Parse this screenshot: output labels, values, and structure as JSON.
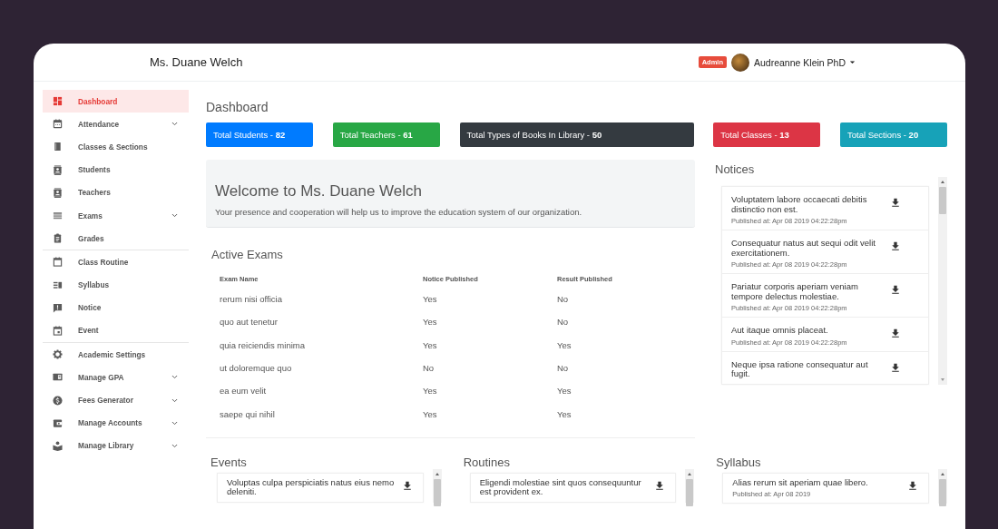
{
  "header": {
    "brand": "Ms. Duane Welch",
    "role_badge": "Admin",
    "user_name": "Audreanne Klein PhD"
  },
  "sidebar": {
    "groups": [
      [
        {
          "label": "Dashboard",
          "selected": true,
          "has_submenu": false
        },
        {
          "label": "Attendance",
          "selected": false,
          "has_submenu": true
        },
        {
          "label": "Classes & Sections",
          "selected": false,
          "has_submenu": false
        },
        {
          "label": "Students",
          "selected": false,
          "has_submenu": false
        },
        {
          "label": "Teachers",
          "selected": false,
          "has_submenu": false
        },
        {
          "label": "Exams",
          "selected": false,
          "has_submenu": true
        },
        {
          "label": "Grades",
          "selected": false,
          "has_submenu": false
        }
      ],
      [
        {
          "label": "Class Routine",
          "selected": false,
          "has_submenu": false
        },
        {
          "label": "Syllabus",
          "selected": false,
          "has_submenu": false
        },
        {
          "label": "Notice",
          "selected": false,
          "has_submenu": false
        },
        {
          "label": "Event",
          "selected": false,
          "has_submenu": false
        }
      ],
      [
        {
          "label": "Academic Settings",
          "selected": false,
          "has_submenu": false
        },
        {
          "label": "Manage GPA",
          "selected": false,
          "has_submenu": true
        },
        {
          "label": "Fees Generator",
          "selected": false,
          "has_submenu": true
        },
        {
          "label": "Manage Accounts",
          "selected": false,
          "has_submenu": true
        },
        {
          "label": "Manage Library",
          "selected": false,
          "has_submenu": true
        }
      ]
    ]
  },
  "page_title": "Dashboard",
  "stats": [
    {
      "label": "Total Students -",
      "value": "82",
      "color": "#007bff"
    },
    {
      "label": "Total Teachers -",
      "value": "61",
      "color": "#28a745"
    },
    {
      "label": "Total Types of Books In Library -",
      "value": "50",
      "color": "#343a40"
    },
    {
      "label": "Total Classes -",
      "value": "13",
      "color": "#dc3545"
    },
    {
      "label": "Total Sections -",
      "value": "20",
      "color": "#17a2b8"
    }
  ],
  "welcome": {
    "title": "Welcome to Ms. Duane Welch",
    "message": "Your presence and cooperation will help us to improve the education system of our organization."
  },
  "active_exams": {
    "title": "Active Exams",
    "columns": [
      "Exam Name",
      "Notice Published",
      "Result Published"
    ],
    "rows": [
      [
        "rerum nisi officia",
        "Yes",
        "No"
      ],
      [
        "quo aut tenetur",
        "Yes",
        "No"
      ],
      [
        "quia reiciendis minima",
        "Yes",
        "Yes"
      ],
      [
        "ut doloremque quo",
        "No",
        "No"
      ],
      [
        "ea eum velit",
        "Yes",
        "Yes"
      ],
      [
        "saepe qui nihil",
        "Yes",
        "Yes"
      ]
    ]
  },
  "notices": {
    "title": "Notices",
    "items": [
      {
        "text": "Voluptatem labore occaecati debitis distinctio non est.",
        "published": "Published at: Apr 08 2019 04:22:28pm"
      },
      {
        "text": "Consequatur natus aut sequi odit velit exercitationem.",
        "published": "Published at: Apr 08 2019 04:22:28pm"
      },
      {
        "text": "Pariatur corporis aperiam veniam tempore delectus molestiae.",
        "published": "Published at: Apr 08 2019 04:22:28pm"
      },
      {
        "text": "Aut itaque omnis placeat.",
        "published": "Published at: Apr 08 2019 04:22:28pm"
      },
      {
        "text": "Neque ipsa ratione consequatur aut fugit."
      }
    ]
  },
  "events": {
    "title": "Events",
    "items": [
      {
        "text": "Voluptas culpa perspiciatis natus eius nemo deleniti."
      }
    ]
  },
  "routines": {
    "title": "Routines",
    "items": [
      {
        "text": "Eligendi molestiae sint quos consequuntur est provident ex."
      }
    ]
  },
  "syllabus": {
    "title": "Syllabus",
    "items": [
      {
        "text": "Alias rerum sit aperiam quae libero.",
        "published": "Published at: Apr 08 2019"
      }
    ]
  }
}
